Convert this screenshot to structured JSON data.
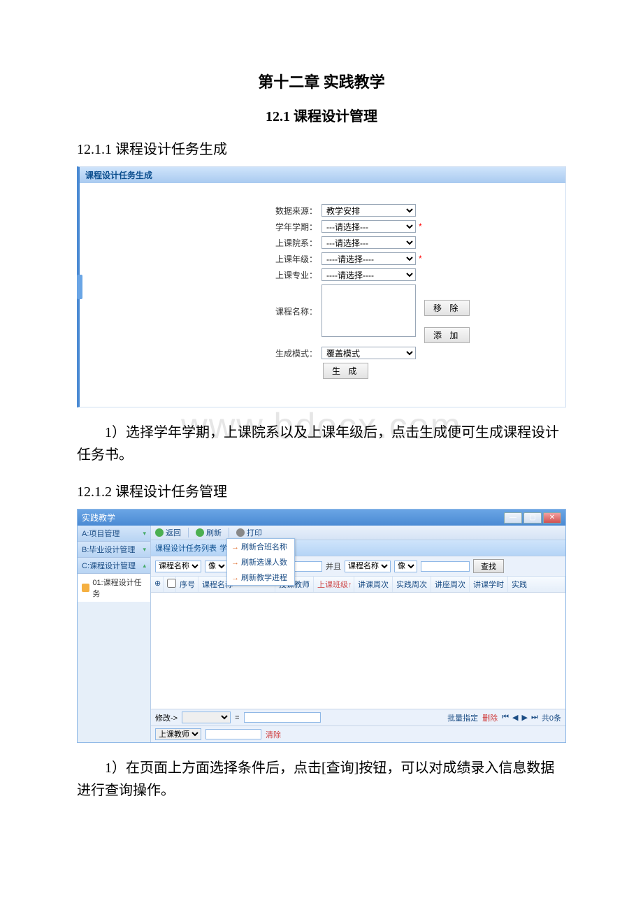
{
  "watermark": "www.bdocx.com",
  "chapter_title": "第十二章 实践教学",
  "section_title": "12.1 课程设计管理",
  "subsection1_title": "12.1.1 课程设计任务生成",
  "shot1": {
    "panel_title": "课程设计任务生成",
    "labels": {
      "source": "数据来源：",
      "term": "学年学期：",
      "dept": "上课院系：",
      "grade": "上课年级：",
      "major": "上课专业：",
      "course": "课程名称：",
      "mode": "生成模式："
    },
    "values": {
      "source": "教学安排",
      "term": "---请选择---",
      "dept": "---请选择---",
      "grade": "----请选择----",
      "major": "----请选择----",
      "mode": "覆盖模式"
    },
    "buttons": {
      "remove": "移 除",
      "add": "添 加",
      "generate": "生 成"
    }
  },
  "para1": "1）选择学年学期，上课院系以及上课年级后，点击生成便可生成课程设计任务书。",
  "subsection2_title": "12.1.2 课程设计任务管理",
  "shot2": {
    "window_title": "实践教学",
    "sidebar": {
      "a": "A:项目管理",
      "b": "B:毕业设计管理",
      "c": "C:课程设计管理",
      "c1": "01:课程设计任务"
    },
    "toolbar": {
      "back": "返回",
      "refresh": "刷新",
      "print": "打印"
    },
    "dropdown": {
      "opt1": "刷新合班名称",
      "opt2": "刷新选课人数",
      "opt3": "刷新教学进程"
    },
    "panel_title_prefix": "课程设计任务列表",
    "panel_title_suffix": "学年",
    "filter": {
      "field1": "课程名称",
      "op1": "像",
      "and": "并且",
      "field2": "课程名称",
      "op2": "像",
      "find": "查找"
    },
    "grid_cols": {
      "seq": "序号",
      "course_name": "课程名称",
      "teacher": "授课教师",
      "class": "上课班级↑",
      "lecture_wk": "讲课周次",
      "practice_wk": "实践周次",
      "seminar_wk": "讲座周次",
      "lecture_hr": "讲课学时",
      "practice_hr": "实践"
    },
    "footer": {
      "modify": "修改->",
      "eq": "=",
      "batch": "批量指定",
      "delete": "删除",
      "count": "共0条",
      "teacher": "上课教师",
      "clear": "清除"
    }
  },
  "para2": "1）在页面上方面选择条件后，点击[查询]按钮，可以对成绩录入信息数据进行查询操作。"
}
